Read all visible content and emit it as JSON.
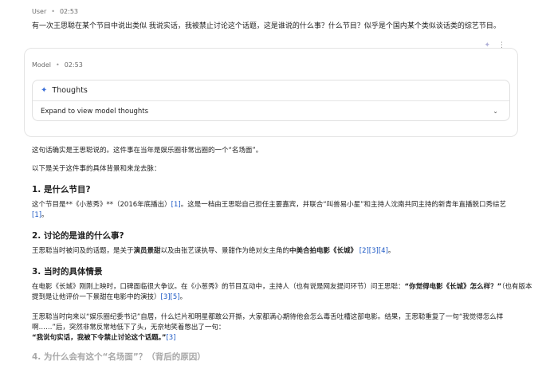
{
  "user": {
    "role": "User",
    "time": "02:53",
    "message": "有一次王思聪在某个节目中说出类似 我说实话，我被禁止讨论这个话题，这是谁说的什么事？什么节目？似乎是个国内某个类似谈话类的综艺节目。"
  },
  "icons": {
    "sparkle": "sparkle-icon",
    "more": "more-vert-icon",
    "chevron": "chevron-down-icon"
  },
  "model": {
    "role": "Model",
    "time": "02:53",
    "thoughts_title": "Thoughts",
    "thoughts_expand": "Expand to view model thoughts"
  },
  "answer": {
    "intro1": "这句话确实是王思聪说的。这件事在当年是娱乐圈非常出圈的一个“名场面”。",
    "intro2": "以下是关于这件事的具体背景和来龙去脉：",
    "s1_title": "1. 是什么节目?",
    "s1_a": "这个节目是**《小葱秀》**（2016年底播出）",
    "s1_c1": "[1]",
    "s1_b": "。这是一档由王思聪自己担任主要嘉宾，并联合“叫兽易小星”和主持人沈南共同主持的新青年直播脱口秀综艺",
    "s1_c2": "[1]",
    "s1_end": "。",
    "s2_title": "2. 讨论的是谁的什么事?",
    "s2_a": "王思聪当时被问及的话题，是关于",
    "s2_b1": "演员景甜",
    "s2_mid": "以及由张艺谋执导、景甜作为绝对女主角的",
    "s2_b2": "中美合拍电影《长城》",
    "s2_cites": "[2][3][4]",
    "s2_end": "。",
    "s3_title": "3. 当时的具体情景",
    "s3_p1_a": "在电影《长城》刚刚上映时，口碑面临很大争议。在《小葱秀》的节目互动中，主持人（也有说是网友提问环节）问王思聪：",
    "s3_p1_b": "“你觉得电影《长城》怎么样？”",
    "s3_p1_c": "（也有版本提到是让他评价一下景甜在电影中的演技）",
    "s3_p1_cites": "[3][5]",
    "s3_p1_end": "。",
    "s3_p2": "王思聪当时向来以“娱乐圈纪委书记”自居，什么烂片和明星都敢公开撕，大家都满心期待他会怎么毒舌吐槽这部电影。结果，王思聪重复了一句“我觉得怎么样啊……”后，突然非常反常地低下了头，无奈地笑着憋出了一句：",
    "s3_quote": "“我说句实话，我被下令禁止讨论这个话题。”",
    "s3_quote_cite": "[3]",
    "s4_title": "4. 为什么会有这个“名场面”？（背后的原因）"
  }
}
